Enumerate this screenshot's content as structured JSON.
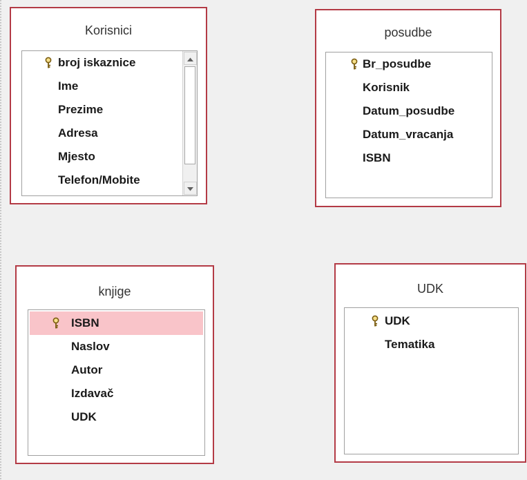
{
  "tables": [
    {
      "title": "Korisnici",
      "fields": [
        {
          "name": "broj iskaznice",
          "key": true
        },
        {
          "name": "Ime"
        },
        {
          "name": "Prezime"
        },
        {
          "name": "Adresa"
        },
        {
          "name": "Mjesto"
        },
        {
          "name": "Telefon/Mobite"
        }
      ]
    },
    {
      "title": "posudbe",
      "fields": [
        {
          "name": "Br_posudbe",
          "key": true
        },
        {
          "name": "Korisnik"
        },
        {
          "name": "Datum_posudbe"
        },
        {
          "name": "Datum_vracanja"
        },
        {
          "name": "ISBN"
        }
      ]
    },
    {
      "title": "knjige",
      "fields": [
        {
          "name": "ISBN",
          "key": true,
          "selected": true
        },
        {
          "name": "Naslov"
        },
        {
          "name": "Autor"
        },
        {
          "name": "Izdavač"
        },
        {
          "name": "UDK"
        }
      ]
    },
    {
      "title": "UDK",
      "fields": [
        {
          "name": "UDK",
          "key": true
        },
        {
          "name": "Tematika"
        }
      ]
    }
  ],
  "colors": {
    "table_border": "#b33a45",
    "selected_row": "#f9c4c9",
    "canvas": "#f0f0f0"
  },
  "icons": {
    "primary_key": "key-icon",
    "scroll_up": "scroll-up-arrow-icon",
    "scroll_down": "scroll-down-arrow-icon"
  }
}
